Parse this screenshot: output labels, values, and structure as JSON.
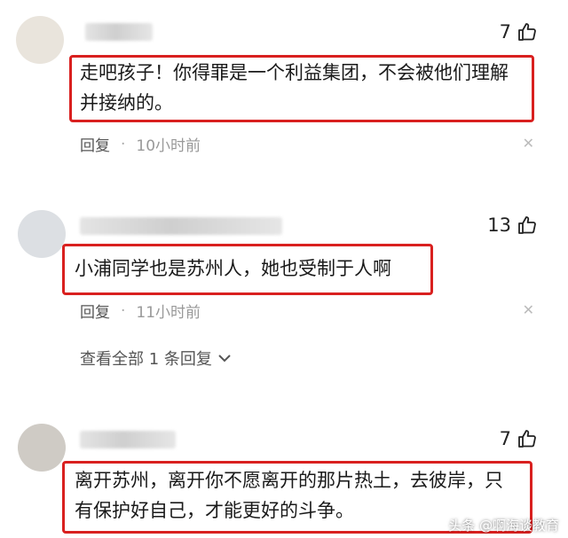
{
  "comments": [
    {
      "likes": "7",
      "text_line1": "走吧孩子！你得罪是一个利益集团，不会被他们理解",
      "text_line2": "并接纳的。",
      "reply": "回复",
      "dot": "·",
      "time": "10小时前",
      "close": "✕"
    },
    {
      "likes": "13",
      "text_line1": "小浦同学也是苏州人，她也受制于人啊",
      "reply": "回复",
      "dot": "·",
      "time": "11小时前",
      "close": "✕",
      "expand": "查看全部 1 条回复"
    },
    {
      "likes": "7",
      "text_line1": "离开苏州，离开你不愿离开的那片热土，去彼岸，只",
      "text_line2": "有保护好自己，才能更好的斗争。"
    }
  ],
  "watermark": "头条 @啊海谈教育",
  "colors": {
    "highlight": "#d9201f"
  }
}
